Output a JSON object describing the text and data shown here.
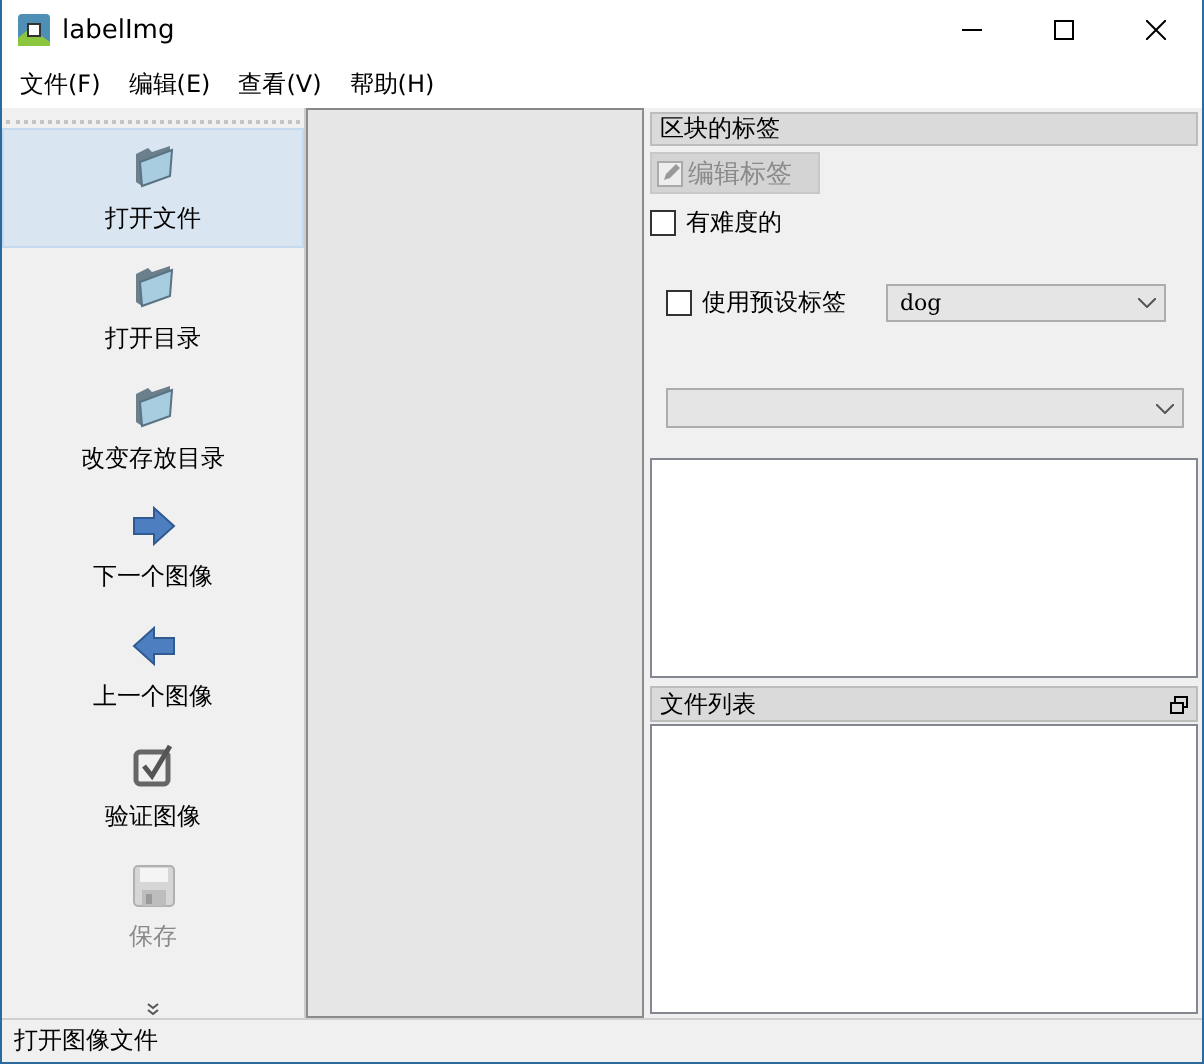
{
  "window": {
    "title": "labelImg"
  },
  "menu": [
    {
      "label": "文件(F)"
    },
    {
      "label": "编辑(E)"
    },
    {
      "label": "查看(V)"
    },
    {
      "label": "帮助(H)"
    }
  ],
  "tools": [
    {
      "label": "打开文件",
      "kind": "folder",
      "selected": true,
      "disabled": false
    },
    {
      "label": "打开目录",
      "kind": "folder",
      "selected": false,
      "disabled": false
    },
    {
      "label": "改变存放目录",
      "kind": "folder",
      "selected": false,
      "disabled": false
    },
    {
      "label": "下一个图像",
      "kind": "next",
      "selected": false,
      "disabled": false
    },
    {
      "label": "上一个图像",
      "kind": "prev",
      "selected": false,
      "disabled": false
    },
    {
      "label": "验证图像",
      "kind": "verify",
      "selected": false,
      "disabled": false
    },
    {
      "label": "保存",
      "kind": "save",
      "selected": false,
      "disabled": true
    }
  ],
  "label_dock": {
    "title": "区块的标签",
    "edit_button": {
      "label": "编辑标签",
      "disabled": true
    },
    "difficult": {
      "label": "有难度的",
      "checked": false
    },
    "default_label": {
      "label": "使用预设标签",
      "checked": false,
      "value": "dog"
    }
  },
  "file_dock": {
    "title": "文件列表"
  },
  "status_bar": "打开图像文件"
}
